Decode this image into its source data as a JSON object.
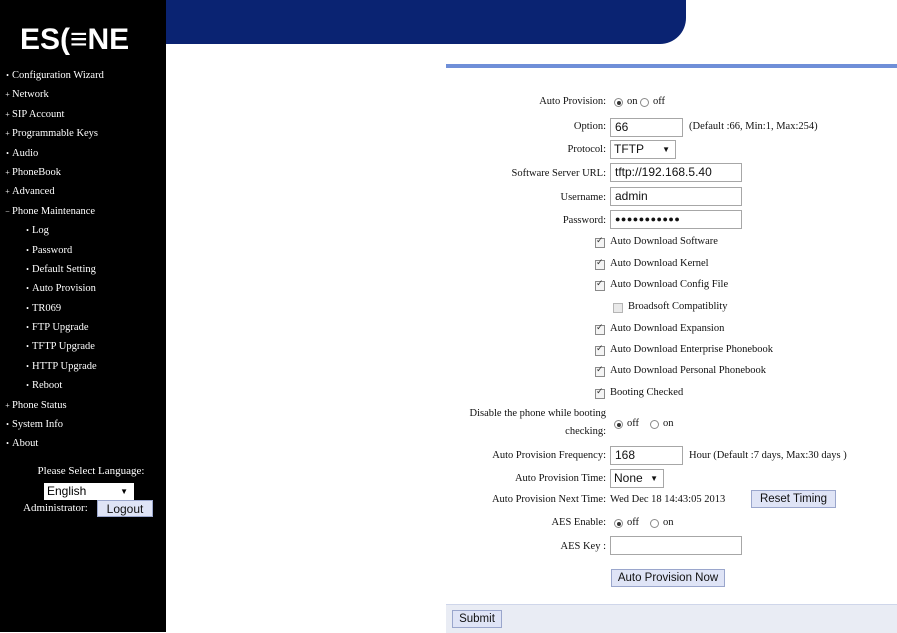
{
  "logo_text": "ES(≡NE",
  "sidebar": {
    "items": [
      {
        "label": "Configuration Wizard",
        "bullet": "•",
        "sub": false
      },
      {
        "label": "Network",
        "bullet": "+",
        "sub": false
      },
      {
        "label": "SIP Account",
        "bullet": "+",
        "sub": false
      },
      {
        "label": "Programmable Keys",
        "bullet": "+",
        "sub": false
      },
      {
        "label": "Audio",
        "bullet": "•",
        "sub": false
      },
      {
        "label": "PhoneBook",
        "bullet": "+",
        "sub": false
      },
      {
        "label": "Advanced",
        "bullet": "+",
        "sub": false
      },
      {
        "label": "Phone Maintenance",
        "bullet": "−",
        "sub": false
      },
      {
        "label": "Log",
        "bullet": "•",
        "sub": true
      },
      {
        "label": "Password",
        "bullet": "•",
        "sub": true
      },
      {
        "label": "Default Setting",
        "bullet": "•",
        "sub": true
      },
      {
        "label": "Auto Provision",
        "bullet": "•",
        "sub": true
      },
      {
        "label": "TR069",
        "bullet": "•",
        "sub": true
      },
      {
        "label": "FTP Upgrade",
        "bullet": "•",
        "sub": true
      },
      {
        "label": "TFTP Upgrade",
        "bullet": "•",
        "sub": true
      },
      {
        "label": "HTTP Upgrade",
        "bullet": "•",
        "sub": true
      },
      {
        "label": "Reboot",
        "bullet": "•",
        "sub": true
      },
      {
        "label": "Phone Status",
        "bullet": "+",
        "sub": false
      },
      {
        "label": "System Info",
        "bullet": "•",
        "sub": false
      },
      {
        "label": "About",
        "bullet": "•",
        "sub": false
      }
    ],
    "language_label": "Please Select Language:",
    "language_value": "English",
    "admin_label": "Administrator:",
    "logout_label": "Logout"
  },
  "form": {
    "auto_provision": {
      "label": "Auto Provision:",
      "on": "on",
      "off": "off",
      "selected": "on"
    },
    "option": {
      "label": "Option:",
      "value": "66",
      "hint": "(Default :66, Min:1, Max:254)"
    },
    "protocol": {
      "label": "Protocol:",
      "value": "TFTP"
    },
    "server_url": {
      "label": "Software Server URL:",
      "value": "tftp://192.168.5.40"
    },
    "username": {
      "label": "Username:",
      "value": "admin"
    },
    "password": {
      "label": "Password:",
      "value": "●●●●●●●●●●●"
    },
    "checkboxes": [
      {
        "label": "Auto Download Software",
        "checked": true
      },
      {
        "label": "Auto Download Kernel",
        "checked": true
      },
      {
        "label": "Auto Download Config File",
        "checked": true
      },
      {
        "label": "Broadsoft Compatiblity",
        "checked": false
      },
      {
        "label": "Auto Download Expansion",
        "checked": true
      },
      {
        "label": "Auto Download Enterprise Phonebook",
        "checked": true
      },
      {
        "label": "Auto Download Personal Phonebook",
        "checked": true
      },
      {
        "label": "Booting Checked",
        "checked": true
      }
    ],
    "disable_phone": {
      "label_line1": "Disable the phone while booting",
      "label_line2": "checking:",
      "off": "off",
      "on": "on",
      "selected": "off"
    },
    "frequency": {
      "label": "Auto Provision Frequency:",
      "value": "168",
      "hint": "Hour (Default :7 days, Max:30 days )"
    },
    "time": {
      "label": "Auto Provision Time:",
      "value": "None"
    },
    "next_time": {
      "label": "Auto Provision Next Time:",
      "value": "Wed Dec 18 14:43:05 2013",
      "reset_label": "Reset Timing"
    },
    "aes_enable": {
      "label": "AES Enable:",
      "off": "off",
      "on": "on",
      "selected": "off"
    },
    "aes_key": {
      "label": "AES Key :",
      "value": ""
    },
    "provision_now_label": "Auto Provision Now",
    "submit_label": "Submit"
  },
  "colors": {
    "banner": "#0a2372",
    "accent_bar": "#6f8fd8",
    "sidebar_bg": "#000000",
    "button_bg": "#dfe4f6"
  }
}
